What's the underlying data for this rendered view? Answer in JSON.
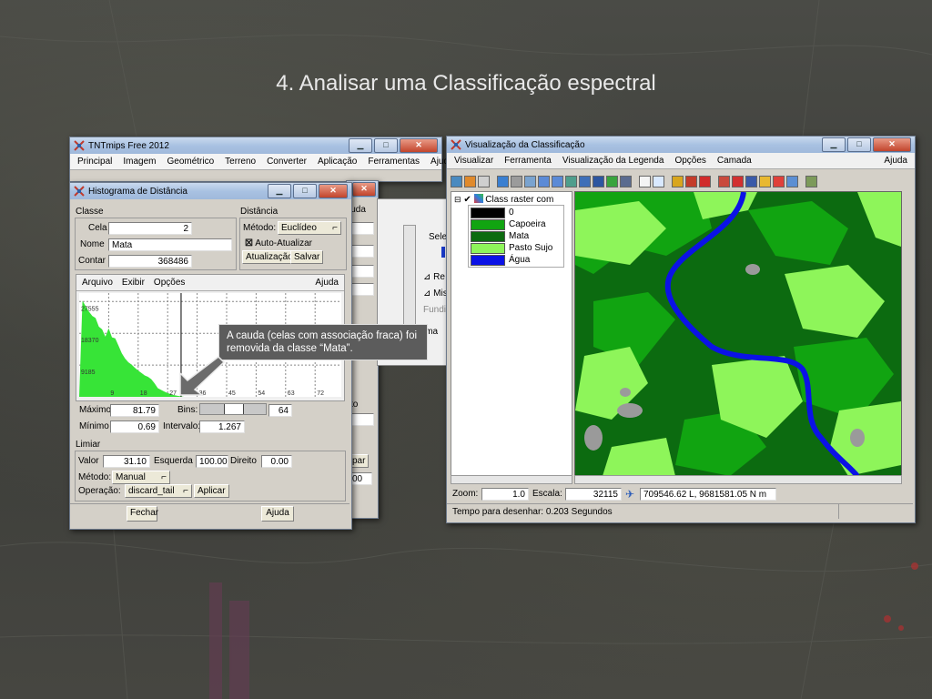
{
  "slide": {
    "title": "4. Analisar uma Classificação espectral"
  },
  "tntmips": {
    "title": "TNTmips Free 2012",
    "menu": [
      "Principal",
      "Imagem",
      "Geométrico",
      "Terreno",
      "Converter",
      "Aplicação",
      "Ferramentas",
      "Ajuda"
    ]
  },
  "behind": {
    "ajuda": "juda",
    "sel": "Sele",
    "re": "Re",
    "mis": "Mis",
    "fundi": "Fundi",
    "ima": "ima",
    "to": "to",
    "par": "par",
    "oo": "00"
  },
  "histogram": {
    "title": "Histograma de Distância",
    "classe": {
      "heading": "Classe",
      "cela_label": "Cela",
      "cela_value": "2",
      "nome_label": "Nome",
      "nome_value": "Mata",
      "contar_label": "Contar",
      "contar_value": "368486"
    },
    "distancia": {
      "heading": "Distância",
      "metodo_label": "Método:",
      "metodo_value": "Euclídeo",
      "auto_label": "Auto-Atualizar",
      "atualizacao": "Atualização",
      "salvar": "Salvar"
    },
    "menu": [
      "Arquivo",
      "Exibir",
      "Opções"
    ],
    "menu_help": "Ajuda",
    "chart_data": {
      "type": "area",
      "x": [
        0,
        1,
        2,
        3,
        4,
        5,
        6,
        7,
        8,
        9,
        10,
        11,
        12,
        13,
        14,
        15,
        16,
        17,
        18,
        19,
        20,
        21,
        22,
        23,
        24,
        25,
        26,
        27,
        28,
        29,
        30,
        31,
        32
      ],
      "values": [
        0,
        27800,
        26200,
        24600,
        23400,
        22800,
        20300,
        19500,
        17400,
        19800,
        17200,
        16900,
        14800,
        12600,
        11100,
        10000,
        9300,
        8400,
        7600,
        6900,
        6200,
        5800,
        5100,
        3900,
        2500,
        2000,
        1500,
        1100,
        800,
        500,
        300,
        150,
        0
      ],
      "y_ticks": [
        "27555",
        "18370",
        "9185"
      ],
      "x_ticks": [
        "9",
        "18",
        "27",
        "36",
        "45",
        "54",
        "63",
        "72"
      ],
      "xlim": [
        0,
        80
      ],
      "ylim": [
        0,
        30000
      ],
      "fill": "#37e437",
      "grid": true
    },
    "stats": {
      "maximo_label": "Máximo",
      "maximo": "81.79",
      "minimo_label": "Mínimo",
      "minimo": "0.69",
      "bins_label": "Bins:",
      "bins": "64",
      "intervalo_label": "Intervalo:",
      "intervalo": "1.267"
    },
    "limiar": {
      "heading": "Limiar",
      "valor_label": "Valor",
      "valor": "31.10",
      "esquerda_label": "Esquerda",
      "esquerda": "100.00",
      "direito_label": "Direito",
      "direito": "0.00",
      "metodo_label": "Método:",
      "metodo": "Manual",
      "operacao_label": "Operação:",
      "operacao": "discard_tail",
      "aplicar": "Aplicar"
    },
    "fechar": "Fechar",
    "ajuda": "Ajuda"
  },
  "callout": {
    "text": "A cauda (celas com associação fraca) foi removida da classe “Mata”."
  },
  "viz": {
    "title": "Visualização da Classificação",
    "menu": [
      "Visualizar",
      "Ferramenta",
      "Visualização da Legenda",
      "Opções",
      "Camada"
    ],
    "menu_help": "Ajuda",
    "legend": {
      "layer": "Class raster com",
      "items": [
        {
          "label": "0",
          "color": "#000000"
        },
        {
          "label": "Capoeira",
          "color": "#11a411"
        },
        {
          "label": "Mata",
          "color": "#0c6b10"
        },
        {
          "label": "Pasto Sujo",
          "color": "#8ef55a"
        },
        {
          "label": "Água",
          "color": "#0b12e6"
        }
      ]
    },
    "status": {
      "zoom_label": "Zoom:",
      "zoom": "1.0",
      "escala_label": "Escala:",
      "escala": "32115",
      "coords": "709546.62 L, 9681581.05 N m",
      "tempo": "Tempo para desenhar: 0.203 Segundos"
    }
  }
}
